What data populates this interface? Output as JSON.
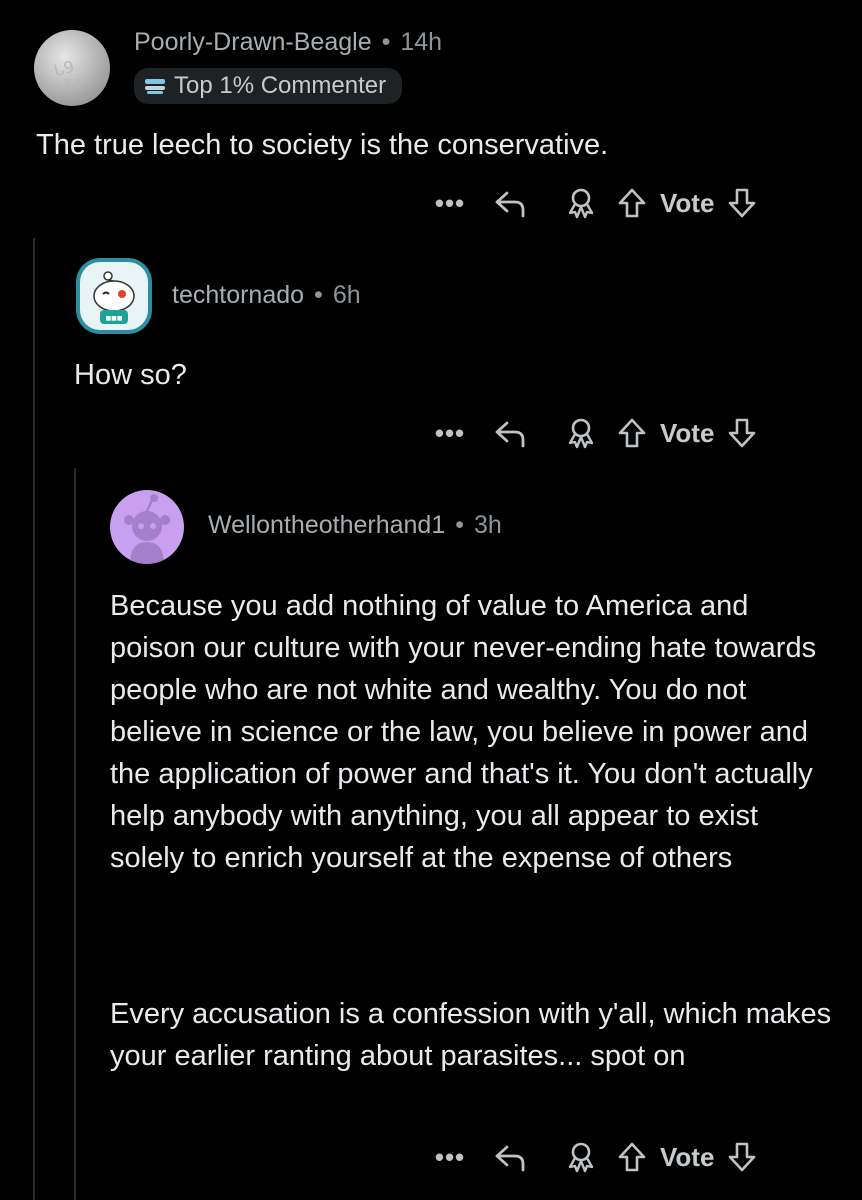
{
  "comments": [
    {
      "username": "Poorly-Drawn-Beagle",
      "separator": "•",
      "time": "14h",
      "flair": "Top 1% Commenter",
      "body": [
        "The true leech to society is the conservative."
      ],
      "actions": {
        "more": "•••",
        "vote_label": "Vote"
      }
    },
    {
      "username": "techtornado",
      "separator": "•",
      "time": "6h",
      "body": [
        "How so?"
      ],
      "actions": {
        "more": "•••",
        "vote_label": "Vote"
      }
    },
    {
      "username": "Wellontheotherhand1",
      "separator": "•",
      "time": "3h",
      "body": [
        "Because you add nothing of value to America and poison our culture with your never-ending hate towards people who are not white and wealthy. You do not believe in science or the law, you believe in power and the application of power and that's it. You don't actually help anybody with anything, you all appear to exist solely to enrich yourself at the expense of others",
        "Every accusation is a confession with y'all, which makes your earlier ranting about parasites... spot on"
      ],
      "actions": {
        "more": "•••",
        "vote_label": "Vote"
      }
    }
  ],
  "icons": {
    "more": "more-options-icon",
    "reply": "reply-icon",
    "award": "award-icon",
    "upvote": "upvote-arrow-icon",
    "downvote": "downvote-arrow-icon"
  },
  "colors": {
    "background": "#000000",
    "text": "#e8eaed",
    "meta": "#8f9498",
    "thread_line": "#2a2d30",
    "avatar_purple": "#c9a0f0",
    "avatar_teal": "#2a8fa0"
  }
}
